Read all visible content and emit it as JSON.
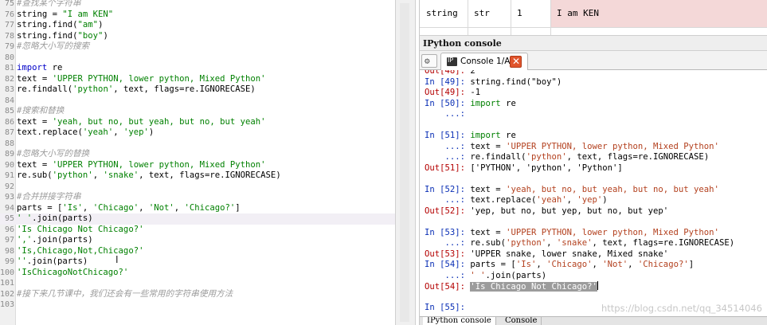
{
  "editor": {
    "lines": [
      {
        "n": "75",
        "t": [
          [
            "cm",
            "#查找某个字符串"
          ]
        ]
      },
      {
        "n": "76",
        "t": [
          [
            "pl",
            "string = "
          ],
          [
            "st",
            "\"I am KEN\""
          ]
        ]
      },
      {
        "n": "77",
        "t": [
          [
            "pl",
            "string.find("
          ],
          [
            "st",
            "\"am\""
          ],
          [
            "pl",
            ")"
          ]
        ]
      },
      {
        "n": "78",
        "t": [
          [
            "pl",
            "string.find("
          ],
          [
            "st",
            "\"boy\""
          ],
          [
            "pl",
            ")"
          ]
        ]
      },
      {
        "n": "79",
        "t": [
          [
            "cm",
            "#忽略大小写的搜索"
          ]
        ]
      },
      {
        "n": "80",
        "t": []
      },
      {
        "n": "81",
        "t": [
          [
            "kw",
            "import"
          ],
          [
            "pl",
            " re"
          ]
        ]
      },
      {
        "n": "82",
        "t": [
          [
            "pl",
            "text = "
          ],
          [
            "st",
            "'UPPER PYTHON, lower python, Mixed Python'"
          ]
        ]
      },
      {
        "n": "83",
        "t": [
          [
            "pl",
            "re.findall("
          ],
          [
            "st",
            "'python'"
          ],
          [
            "pl",
            ", text, flags=re.IGNORECASE)"
          ]
        ]
      },
      {
        "n": "84",
        "t": []
      },
      {
        "n": "85",
        "t": [
          [
            "cm",
            "#搜索和替换"
          ]
        ]
      },
      {
        "n": "86",
        "t": [
          [
            "pl",
            "text = "
          ],
          [
            "st",
            "'yeah, but no, but yeah, but no, but yeah'"
          ]
        ]
      },
      {
        "n": "87",
        "t": [
          [
            "pl",
            "text.replace("
          ],
          [
            "st",
            "'yeah'"
          ],
          [
            "pl",
            ", "
          ],
          [
            "st",
            "'yep'"
          ],
          [
            "pl",
            ")"
          ]
        ]
      },
      {
        "n": "88",
        "t": []
      },
      {
        "n": "89",
        "t": [
          [
            "cm",
            "#忽略大小写的替换"
          ]
        ]
      },
      {
        "n": "90",
        "t": [
          [
            "pl",
            "text = "
          ],
          [
            "st",
            "'UPPER PYTHON, lower python, Mixed Python'"
          ]
        ]
      },
      {
        "n": "91",
        "t": [
          [
            "pl",
            "re.sub("
          ],
          [
            "st",
            "'python'"
          ],
          [
            "pl",
            ", "
          ],
          [
            "st",
            "'snake'"
          ],
          [
            "pl",
            ", text, flags=re.IGNORECASE)"
          ]
        ]
      },
      {
        "n": "92",
        "t": []
      },
      {
        "n": "93",
        "t": [
          [
            "cm",
            "#合并拼接字符串"
          ]
        ]
      },
      {
        "n": "94",
        "t": [
          [
            "pl",
            "parts = ["
          ],
          [
            "st",
            "'Is'"
          ],
          [
            "pl",
            ", "
          ],
          [
            "st",
            "'Chicago'"
          ],
          [
            "pl",
            ", "
          ],
          [
            "st",
            "'Not'"
          ],
          [
            "pl",
            ", "
          ],
          [
            "st",
            "'Chicago?'"
          ],
          [
            "pl",
            "]"
          ]
        ]
      },
      {
        "n": "95",
        "t": [
          [
            "st",
            "' '"
          ],
          [
            "pl",
            ".join(parts)"
          ]
        ],
        "active": true
      },
      {
        "n": "96",
        "t": [
          [
            "st",
            "'Is Chicago Not Chicago?'"
          ]
        ]
      },
      {
        "n": "97",
        "t": [
          [
            "st",
            "','"
          ],
          [
            "pl",
            ".join(parts)"
          ]
        ]
      },
      {
        "n": "98",
        "t": [
          [
            "st",
            "'Is,Chicago,Not,Chicago?'"
          ]
        ]
      },
      {
        "n": "99",
        "t": [
          [
            "st",
            "''"
          ],
          [
            "pl",
            ".join(parts)"
          ]
        ]
      },
      {
        "n": "100",
        "t": [
          [
            "st",
            "'IsChicagoNotChicago?'"
          ]
        ]
      },
      {
        "n": "101",
        "t": []
      },
      {
        "n": "102",
        "t": [
          [
            "cm",
            "#接下来几节课中，我们还会有一些常用的字符串使用方法"
          ]
        ]
      },
      {
        "n": "103",
        "t": []
      }
    ]
  },
  "variable_explorer": {
    "row": {
      "name": "string",
      "type": "str",
      "size": "1",
      "value": "I am KEN"
    },
    "colors": {
      "highlight": "#f4d8d8"
    }
  },
  "console": {
    "pane_title": "IPython console",
    "tab_label": "Console 1/A",
    "tab_icon_text": "IP",
    "close_glyph": "✕",
    "options_glyph": "⚙",
    "lines": [
      [
        [
          "out",
          "Out[48]: "
        ],
        [
          "pl",
          "2"
        ]
      ],
      [
        [
          "in",
          "In [49]: "
        ],
        [
          "pl",
          "string.find(\"boy\")"
        ]
      ],
      [
        [
          "out",
          "Out[49]: "
        ],
        [
          "pl",
          "-1"
        ]
      ],
      [
        [
          "in",
          "In [50]: "
        ],
        [
          "kw",
          "import"
        ],
        [
          "pl",
          " re"
        ]
      ],
      [
        [
          "cont",
          "    ...: "
        ]
      ],
      [],
      [
        [
          "in",
          "In [51]: "
        ],
        [
          "kw",
          "import"
        ],
        [
          "pl",
          " re"
        ]
      ],
      [
        [
          "cont",
          "    ...: "
        ],
        [
          "pl",
          "text = "
        ],
        [
          "st",
          "'UPPER PYTHON, lower python, Mixed Python'"
        ]
      ],
      [
        [
          "cont",
          "    ...: "
        ],
        [
          "pl",
          "re.findall("
        ],
        [
          "st",
          "'python'"
        ],
        [
          "pl",
          ", text, flags=re.IGNORECASE)"
        ]
      ],
      [
        [
          "out",
          "Out[51]: "
        ],
        [
          "pl",
          "['PYTHON', 'python', 'Python']"
        ]
      ],
      [],
      [
        [
          "in",
          "In [52]: "
        ],
        [
          "pl",
          "text = "
        ],
        [
          "st",
          "'yeah, but no, but yeah, but no, but yeah'"
        ]
      ],
      [
        [
          "cont",
          "    ...: "
        ],
        [
          "pl",
          "text.replace("
        ],
        [
          "st",
          "'yeah'"
        ],
        [
          "pl",
          ", "
        ],
        [
          "st",
          "'yep'"
        ],
        [
          "pl",
          ")"
        ]
      ],
      [
        [
          "out",
          "Out[52]: "
        ],
        [
          "pl",
          "'yep, but no, but yep, but no, but yep'"
        ]
      ],
      [],
      [
        [
          "in",
          "In [53]: "
        ],
        [
          "pl",
          "text = "
        ],
        [
          "st",
          "'UPPER PYTHON, lower python, Mixed Python'"
        ]
      ],
      [
        [
          "cont",
          "    ...: "
        ],
        [
          "pl",
          "re.sub("
        ],
        [
          "st",
          "'python'"
        ],
        [
          "pl",
          ", "
        ],
        [
          "st",
          "'snake'"
        ],
        [
          "pl",
          ", text, flags=re.IGNORECASE)"
        ]
      ],
      [
        [
          "out",
          "Out[53]: "
        ],
        [
          "pl",
          "'UPPER snake, lower snake, Mixed snake'"
        ]
      ],
      [
        [
          "in",
          "In [54]: "
        ],
        [
          "pl",
          "parts = ["
        ],
        [
          "st",
          "'Is'"
        ],
        [
          "pl",
          ", "
        ],
        [
          "st",
          "'Chicago'"
        ],
        [
          "pl",
          ", "
        ],
        [
          "st",
          "'Not'"
        ],
        [
          "pl",
          ", "
        ],
        [
          "st",
          "'Chicago?'"
        ],
        [
          "pl",
          "]"
        ]
      ],
      [
        [
          "cont",
          "    ...: "
        ],
        [
          "st",
          "' '"
        ],
        [
          "pl",
          ".join(parts)"
        ]
      ],
      [
        [
          "out",
          "Out[54]: "
        ],
        [
          "sel",
          "'Is Chicago Not Chicago?'"
        ],
        [
          "caret",
          ""
        ]
      ],
      [],
      [
        [
          "in",
          "In [55]: "
        ]
      ]
    ],
    "bottom_tabs": [
      "IPython console",
      "Console"
    ],
    "colors": {
      "prompt_in": "#0a2fb5",
      "prompt_out": "#b40000",
      "keyword": "#008000",
      "string": "#b3401e"
    }
  },
  "watermark": "https://blog.csdn.net/qq_34514046"
}
